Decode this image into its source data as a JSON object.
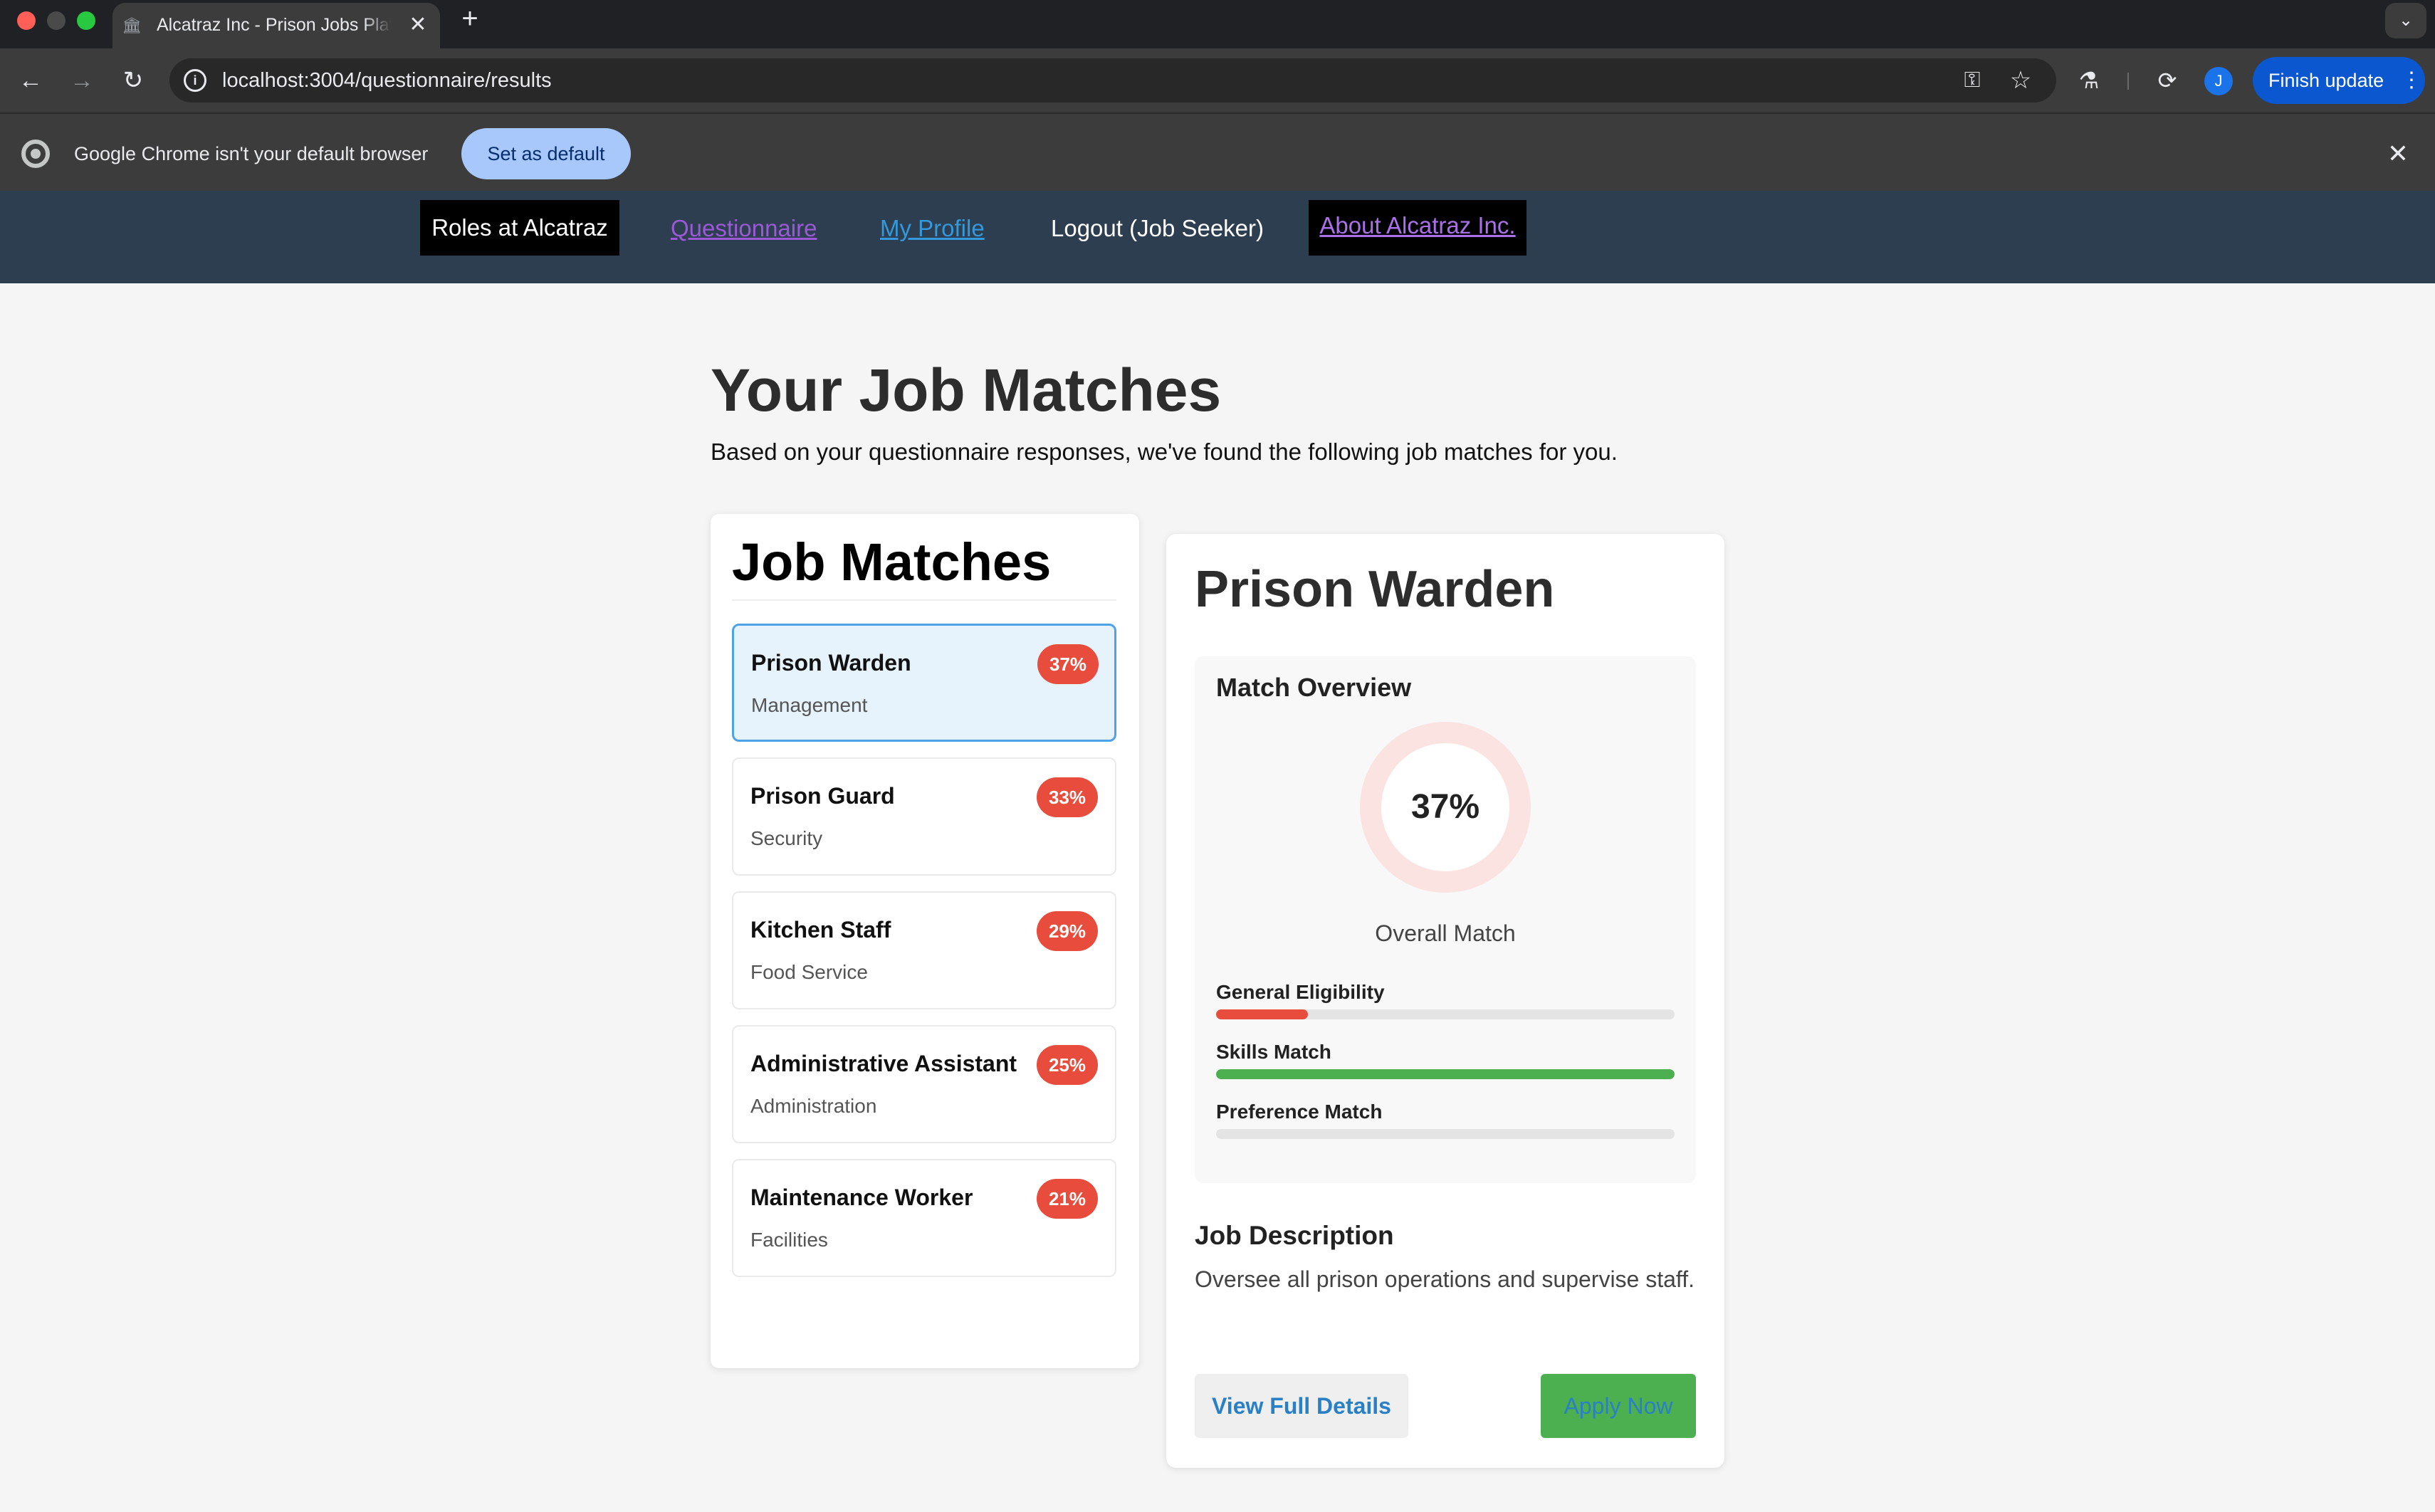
{
  "browser": {
    "tab_title": "Alcatraz Inc - Prison Jobs Platform",
    "tab_favicon": "🏛",
    "tab_close": "✕",
    "new_tab": "+",
    "tab_menu": "⌄",
    "back": "←",
    "forward": "→",
    "reload": "↻",
    "info": "i",
    "url": "localhost:3004/questionnaire/results",
    "key": "⚿",
    "star": "☆",
    "lab": "⚗",
    "perf": "⟳",
    "profile_initial": "J",
    "finish_update": "Finish update",
    "finish_dots": "⋮"
  },
  "infobar": {
    "message": "Google Chrome isn't your default browser",
    "button": "Set as default",
    "close": "✕"
  },
  "site_nav": {
    "brand": "Roles at Alcatraz",
    "questionnaire": "Questionnaire",
    "profile": "My Profile",
    "logout": "Logout (Job Seeker)",
    "about": "About Alcatraz Inc."
  },
  "page": {
    "title": "Your Job Matches",
    "subtitle": "Based on your questionnaire responses, we've found the following job matches for you."
  },
  "matches": {
    "heading": "Job Matches",
    "items": [
      {
        "title": "Prison Warden",
        "category": "Management",
        "score": "37%"
      },
      {
        "title": "Prison Guard",
        "category": "Security",
        "score": "33%"
      },
      {
        "title": "Kitchen Staff",
        "category": "Food Service",
        "score": "29%"
      },
      {
        "title": "Administrative Assistant",
        "category": "Administration",
        "score": "25%"
      },
      {
        "title": "Maintenance Worker",
        "category": "Facilities",
        "score": "21%"
      }
    ]
  },
  "detail": {
    "title": "Prison Warden",
    "overview_title": "Match Overview",
    "overall_value": "37%",
    "overall_caption": "Overall Match",
    "bars": [
      {
        "label": "General Eligibility",
        "fraction": 0.2,
        "color": "#e74c3c"
      },
      {
        "label": "Skills Match",
        "fraction": 1.0,
        "color": "#4caf50"
      },
      {
        "label": "Preference Match",
        "fraction": 0.0,
        "color": "#e74c3c"
      }
    ],
    "description_title": "Job Description",
    "description": "Oversee all prison operations and supervise staff.",
    "view_details": "View Full Details",
    "apply": "Apply Now"
  },
  "colors": {
    "nav_bg": "#2c3e50",
    "badge": "#e74c3c",
    "selected_bg": "#e6f2fc",
    "apply_bg": "#4caf50",
    "link_blue": "#2a80c6"
  }
}
